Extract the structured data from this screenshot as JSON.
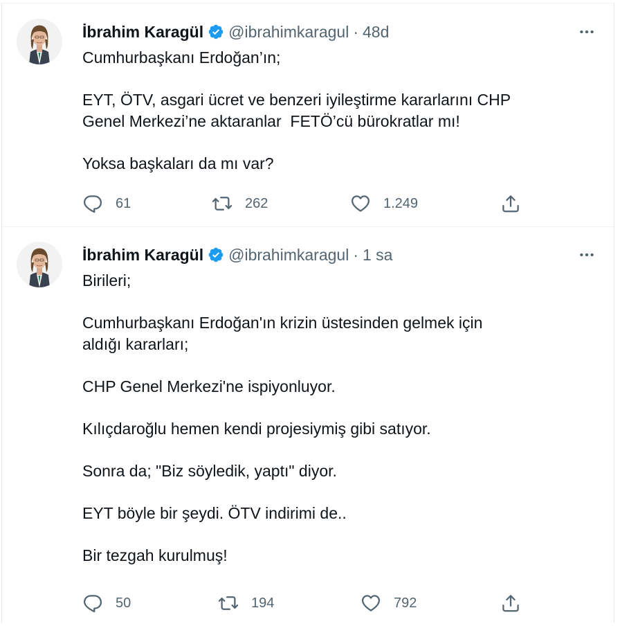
{
  "tweets": [
    {
      "author": "İbrahim Karagül",
      "handle": "@ibrahimkaragul",
      "time": "48d",
      "paragraphs": [
        "Cumhurbaşkanı Erdoğan’ın;",
        "EYT, ÖTV, asgari ücret ve benzeri iyileştirme kararlarını CHP\nGenel Merkezi’ne aktaranlar  FETÖ’cü bürokratlar mı!",
        "Yoksa başkaları da mı var?"
      ],
      "replies": "61",
      "retweets": "262",
      "likes": "1.249"
    },
    {
      "author": "İbrahim Karagül",
      "handle": "@ibrahimkaragul",
      "time": "1 sa",
      "paragraphs": [
        "Birileri;",
        "Cumhurbaşkanı Erdoğan'ın krizin üstesinden gelmek için\naldığı kararları;",
        "CHP Genel Merkezi'ne ispiyonluyor.",
        "Kılıçdaroğlu hemen kendi projesiymiş gibi satıyor.",
        "Sonra da; \"Biz söyledik, yaptı\" diyor.",
        "EYT böyle bir şeydi. ÖTV indirimi de..",
        "Bir tezgah kurulmuş!"
      ],
      "replies": "50",
      "retweets": "194",
      "likes": "792"
    }
  ],
  "colors": {
    "verified": "#1d9bf0",
    "text": "#0f1419",
    "secondary": "#536471",
    "divider": "#eff3f4"
  },
  "icons": [
    "verified-badge-icon",
    "more-icon",
    "reply-icon",
    "retweet-icon",
    "like-icon",
    "share-icon"
  ]
}
